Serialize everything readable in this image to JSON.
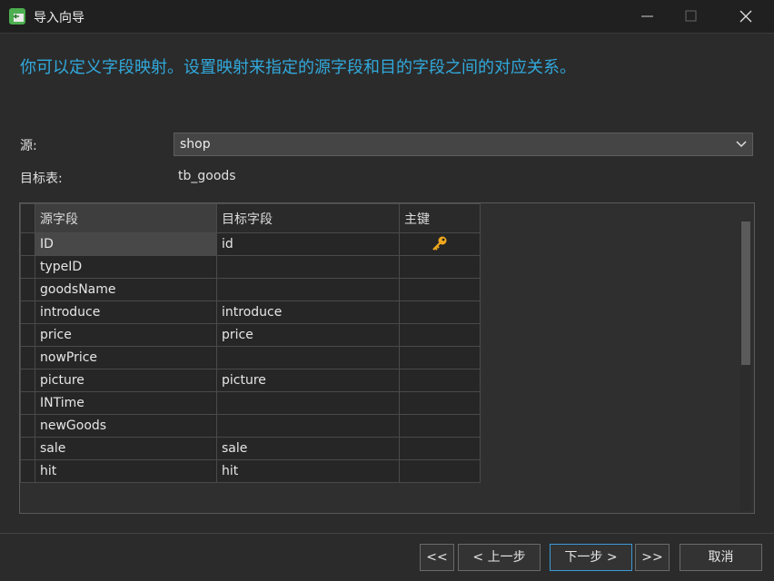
{
  "window": {
    "title": "导入向导"
  },
  "instruction": "你可以定义字段映射。设置映射来指定的源字段和目的字段之间的对应关系。",
  "form": {
    "source_label": "源:",
    "source_value": "shop",
    "target_label": "目标表:",
    "target_value": "tb_goods"
  },
  "grid": {
    "columns": [
      "源字段",
      "目标字段",
      "主键"
    ],
    "rows": [
      {
        "source": "ID",
        "target": "id",
        "primary_key": true
      },
      {
        "source": "typeID",
        "target": "",
        "primary_key": false
      },
      {
        "source": "goodsName",
        "target": "",
        "primary_key": false
      },
      {
        "source": "introduce",
        "target": "introduce",
        "primary_key": false
      },
      {
        "source": "price",
        "target": "price",
        "primary_key": false
      },
      {
        "source": "nowPrice",
        "target": "",
        "primary_key": false
      },
      {
        "source": "picture",
        "target": "picture",
        "primary_key": false
      },
      {
        "source": "INTime",
        "target": "",
        "primary_key": false
      },
      {
        "source": "newGoods",
        "target": "",
        "primary_key": false
      },
      {
        "source": "sale",
        "target": "sale",
        "primary_key": false
      },
      {
        "source": "hit",
        "target": "hit",
        "primary_key": false
      }
    ]
  },
  "buttons": {
    "first": "<<",
    "prev": "< 上一步",
    "next": "下一步 >",
    "last": ">>",
    "cancel": "取消"
  },
  "colors": {
    "accent": "#31a9dc",
    "key_icon": "#f0a81c",
    "app_icon": "#4caf50",
    "primary_button_border": "#3b9ad6"
  },
  "icons": {
    "app": "import-wizard-icon",
    "minimize": "minimize-icon",
    "maximize": "maximize-icon",
    "close": "close-icon",
    "dropdown": "chevron-down-icon",
    "primary_key": "key-icon"
  }
}
